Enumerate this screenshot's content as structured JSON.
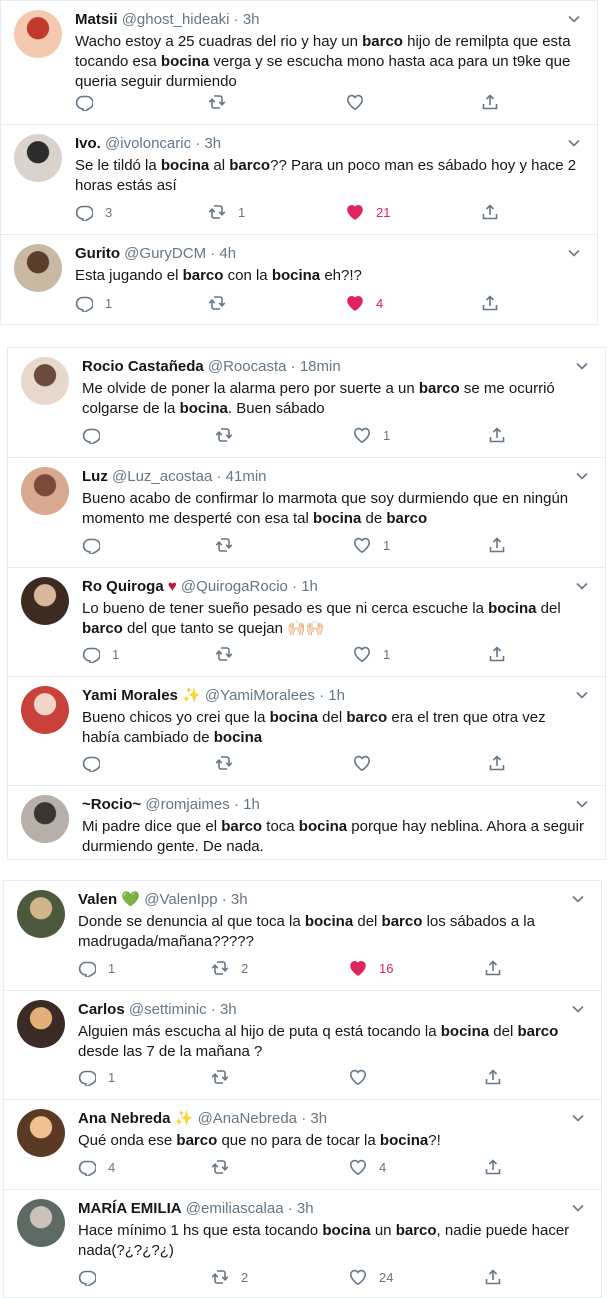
{
  "colors": {
    "text": "#14171a",
    "secondary": "#657786",
    "like": "#e0245e",
    "border": "#e6ecf0"
  },
  "panels": [
    {
      "tweets": [
        {
          "name": "Matsii",
          "handle": "@ghost_hideaki",
          "dot": "·",
          "time": "3h",
          "text": [
            [
              "Wacho estoy a 25 cuadras del rio y hay un ",
              false
            ],
            [
              "barco",
              true
            ],
            [
              " hijo de remilpta que esta tocando esa ",
              false
            ],
            [
              "bocina",
              true
            ],
            [
              " verga y se escucha mono hasta aca para un t9ke que queria seguir durmiendo",
              false
            ]
          ],
          "reply": "",
          "retweet": "",
          "like": "",
          "liked": false
        },
        {
          "name": "Ivo.",
          "handle": "@ivoloncaric",
          "dot": "·",
          "time": "3h",
          "text": [
            [
              "Se le tildó la ",
              false
            ],
            [
              "bocina",
              true
            ],
            [
              " al ",
              false
            ],
            [
              "barco",
              true
            ],
            [
              "?? Para un poco man es sábado hoy y hace 2 horas estás así",
              false
            ]
          ],
          "reply": "3",
          "retweet": "1",
          "like": "21",
          "liked": true
        },
        {
          "name": "Gurito",
          "handle": "@GuryDCM",
          "dot": "·",
          "time": "4h",
          "text": [
            [
              "Esta jugando el ",
              false
            ],
            [
              "barco",
              true
            ],
            [
              " con la ",
              false
            ],
            [
              "bocina",
              true
            ],
            [
              " eh?!?",
              false
            ]
          ],
          "reply": "1",
          "retweet": "",
          "like": "4",
          "liked": true
        }
      ]
    },
    {
      "tweets": [
        {
          "name": "Rocio Castañeda",
          "handle": "@Roocasta",
          "dot": "·",
          "time": "18min",
          "text": [
            [
              "Me olvide de poner la alarma pero por suerte a un ",
              false
            ],
            [
              "barco",
              true
            ],
            [
              " se me ocurrió colgarse de la ",
              false
            ],
            [
              "bocina",
              true
            ],
            [
              ". Buen sábado",
              false
            ]
          ],
          "reply": "",
          "retweet": "",
          "like": "1",
          "liked": false
        },
        {
          "name": "Luz",
          "handle": "@Luz_acostaa",
          "dot": "·",
          "time": "41min",
          "text": [
            [
              "Bueno acabo de confirmar lo marmota que soy durmiendo que en ningún momento me desperté con esa tal ",
              false
            ],
            [
              "bocina",
              true
            ],
            [
              " de ",
              false
            ],
            [
              "barco",
              true
            ]
          ],
          "reply": "",
          "retweet": "",
          "like": "1",
          "liked": false
        },
        {
          "name": "Ro Quiroga",
          "name_emoji": "♥",
          "handle": "@QuirogaRocio",
          "dot": "·",
          "time": "1h",
          "text": [
            [
              "Lo bueno de tener sueño pesado es que ni cerca escuche la ",
              false
            ],
            [
              "bocina",
              true
            ],
            [
              " del ",
              false
            ],
            [
              "barco",
              true
            ],
            [
              " del que tanto se quejan ",
              false
            ],
            [
              "🙌🏻🙌🏻",
              false
            ]
          ],
          "reply": "1",
          "retweet": "",
          "like": "1",
          "liked": false
        },
        {
          "name": "Yami Morales",
          "name_emoji": "✨",
          "handle": "@YamiMoralees",
          "dot": "·",
          "time": "1h",
          "text": [
            [
              "Bueno chicos yo crei que la ",
              false
            ],
            [
              "bocina",
              true
            ],
            [
              " del ",
              false
            ],
            [
              "barco",
              true
            ],
            [
              " era el tren que otra vez había cambiado de ",
              false
            ],
            [
              "bocina",
              true
            ]
          ],
          "reply": "",
          "retweet": "",
          "like": "",
          "liked": false
        },
        {
          "name": "~Rocio~",
          "handle": "@romjaimes",
          "dot": "·",
          "time": "1h",
          "text": [
            [
              "Mi padre dice que el ",
              false
            ],
            [
              "barco",
              true
            ],
            [
              " toca ",
              false
            ],
            [
              "bocina",
              true
            ],
            [
              " porque hay neblina. Ahora a seguir durmiendo gente. De nada.",
              false
            ]
          ],
          "reply": "",
          "retweet": "",
          "like": "",
          "liked": false,
          "no_actions": true
        }
      ]
    },
    {
      "tweets": [
        {
          "name": "Valen",
          "name_emoji": "💚",
          "handle": "@ValenIpp",
          "dot": "·",
          "time": "3h",
          "text": [
            [
              "Donde se denuncia al que toca la ",
              false
            ],
            [
              "bocina",
              true
            ],
            [
              " del ",
              false
            ],
            [
              "barco",
              true
            ],
            [
              " los sábados a la madrugada/mañana?????",
              false
            ]
          ],
          "reply": "1",
          "retweet": "2",
          "like": "16",
          "liked": true
        },
        {
          "name": "Carlos",
          "handle": "@settiminic",
          "dot": "·",
          "time": "3h",
          "text": [
            [
              "Alguien más escucha al hijo de puta q está tocando la ",
              false
            ],
            [
              "bocina",
              true
            ],
            [
              " del ",
              false
            ],
            [
              "barco",
              true
            ],
            [
              " desde las 7 de la mañana ?",
              false
            ]
          ],
          "reply": "1",
          "retweet": "",
          "like": "",
          "liked": false
        },
        {
          "name": "Ana Nebreda",
          "name_emoji": "✨",
          "handle": "@AnaNebreda",
          "dot": "·",
          "time": "3h",
          "text": [
            [
              "Qué onda ese ",
              false
            ],
            [
              "barco",
              true
            ],
            [
              " que no para de tocar la ",
              false
            ],
            [
              "bocina",
              true
            ],
            [
              "?!",
              false
            ]
          ],
          "reply": "4",
          "retweet": "",
          "like": "4",
          "liked": false
        },
        {
          "name": "MARÍA EMILIA",
          "handle": "@emiliascalaa",
          "dot": "·",
          "time": "3h",
          "text": [
            [
              "Hace mínimo 1 hs que esta tocando ",
              false
            ],
            [
              "bocina",
              true
            ],
            [
              " un ",
              false
            ],
            [
              "barco",
              true
            ],
            [
              ", nadie puede hacer nada(?¿?¿?¿)",
              false
            ]
          ],
          "reply": "",
          "retweet": "2",
          "like": "24",
          "liked": false
        }
      ]
    }
  ]
}
